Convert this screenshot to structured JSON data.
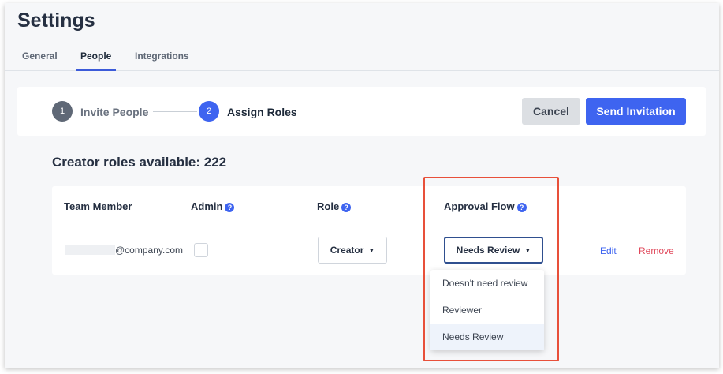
{
  "page": {
    "title": "Settings"
  },
  "tabs": [
    {
      "label": "General",
      "active": false
    },
    {
      "label": "People",
      "active": true
    },
    {
      "label": "Integrations",
      "active": false
    }
  ],
  "stepper": {
    "steps": [
      {
        "number": "1",
        "label": "Invite People",
        "state": "done"
      },
      {
        "number": "2",
        "label": "Assign Roles",
        "state": "current"
      }
    ],
    "cancel_label": "Cancel",
    "send_label": "Send Invitation"
  },
  "roles": {
    "available_text": "Creator roles available: 222"
  },
  "table": {
    "headers": {
      "team_member": "Team Member",
      "admin": "Admin",
      "role": "Role",
      "approval_flow": "Approval Flow"
    },
    "help_icon_glyph": "?",
    "row": {
      "email_suffix": "@company.com",
      "role_value": "Creator",
      "approval_value": "Needs Review",
      "edit_label": "Edit",
      "remove_label": "Remove"
    }
  },
  "approval_dropdown": {
    "options": [
      {
        "label": "Doesn't need review",
        "selected": false
      },
      {
        "label": "Reviewer",
        "selected": false
      },
      {
        "label": "Needs Review",
        "selected": true
      }
    ]
  },
  "colors": {
    "accent": "#3e64f0",
    "danger": "#e0475a",
    "highlight": "#e8503a",
    "step_done": "#5f6876"
  }
}
